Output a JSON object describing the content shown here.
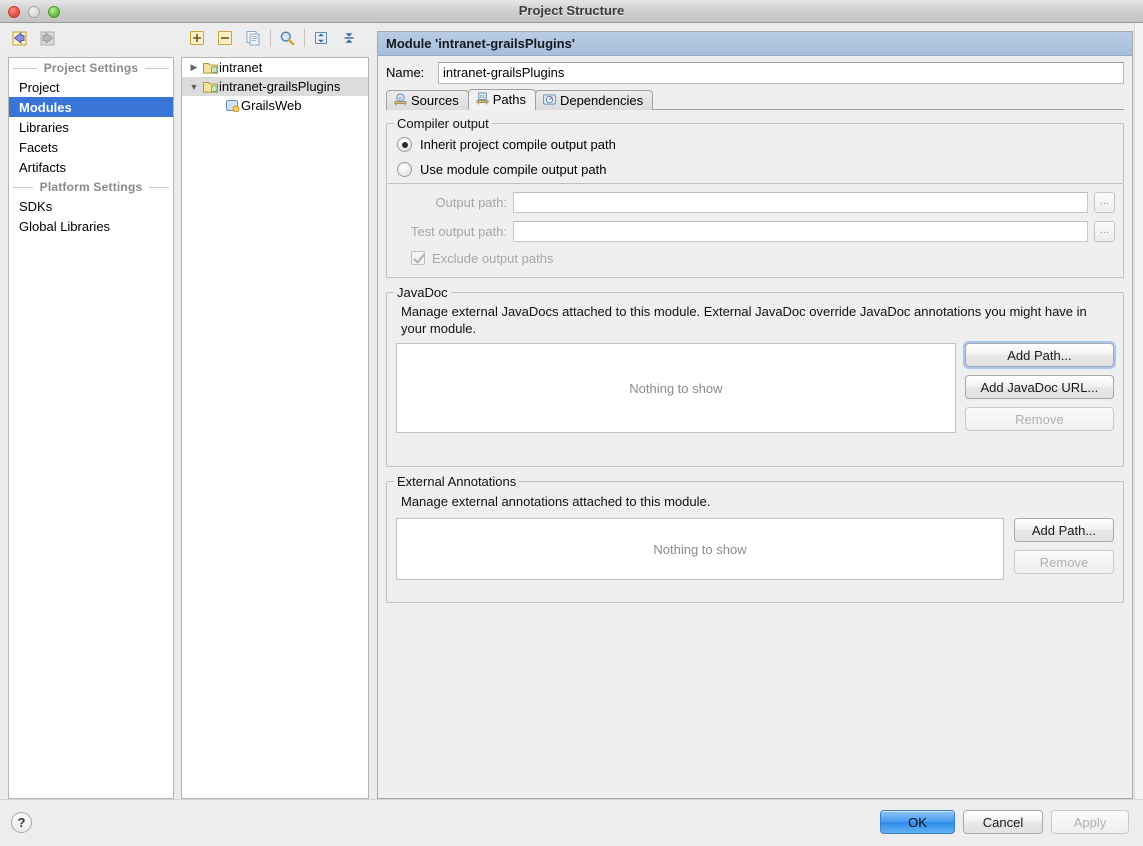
{
  "window": {
    "title": "Project Structure",
    "traffic_lights": [
      "close-button",
      "minimize-button",
      "maximize-button"
    ]
  },
  "nav_toolbar": {
    "items": [
      {
        "name": "back-button",
        "icon": "arrow-left-icon",
        "enabled": true
      },
      {
        "name": "forward-button",
        "icon": "arrow-right-icon",
        "enabled": false
      }
    ]
  },
  "tree_toolbar": {
    "items": [
      {
        "name": "add-button",
        "icon": "plus-icon"
      },
      {
        "name": "remove-button",
        "icon": "minus-icon"
      },
      {
        "name": "copy-button",
        "icon": "copy-icon"
      },
      {
        "name": "find-button",
        "icon": "search-icon"
      },
      {
        "name": "expand-all-button",
        "icon": "expand-all-icon"
      },
      {
        "name": "collapse-all-button",
        "icon": "collapse-all-icon"
      }
    ]
  },
  "sidebar": {
    "sections": [
      {
        "header": "Project Settings",
        "items": [
          {
            "label": "Project",
            "selected": false
          },
          {
            "label": "Modules",
            "selected": true
          },
          {
            "label": "Libraries",
            "selected": false
          },
          {
            "label": "Facets",
            "selected": false
          },
          {
            "label": "Artifacts",
            "selected": false
          }
        ]
      },
      {
        "header": "Platform Settings",
        "items": [
          {
            "label": "SDKs",
            "selected": false
          },
          {
            "label": "Global Libraries",
            "selected": false
          }
        ]
      }
    ]
  },
  "tree": {
    "rows": [
      {
        "label": "intranet",
        "twisty": "collapsed",
        "icon": "module-folder-icon",
        "indent": 0,
        "selected": false
      },
      {
        "label": "intranet-grailsPlugins",
        "twisty": "expanded",
        "icon": "module-folder-icon",
        "indent": 0,
        "selected": true
      },
      {
        "label": "GrailsWeb",
        "twisty": "none",
        "icon": "facet-icon",
        "indent": 1,
        "selected": false
      }
    ]
  },
  "editor": {
    "header_title": "Module 'intranet-grailsPlugins'",
    "name_label": "Name:",
    "name_value": "intranet-grailsPlugins",
    "name_placeholder": "",
    "tabs": [
      {
        "label": "Sources",
        "icon": "sources-icon",
        "active": false
      },
      {
        "label": "Paths",
        "icon": "paths-icon",
        "active": true
      },
      {
        "label": "Dependencies",
        "icon": "dependencies-icon",
        "active": false
      }
    ],
    "compiler_output": {
      "legend": "Compiler output",
      "radio_inherit": {
        "label": "Inherit project compile output path",
        "selected": true
      },
      "radio_module": {
        "label": "Use module compile output path",
        "selected": false
      },
      "output_path": {
        "label": "Output path:",
        "value": "",
        "browse": "...",
        "enabled": false
      },
      "test_output_path": {
        "label": "Test output path:",
        "value": "",
        "browse": "...",
        "enabled": false
      },
      "exclude_checkbox": {
        "label": "Exclude output paths",
        "checked": true,
        "enabled": false
      }
    },
    "javadoc": {
      "legend": "JavaDoc",
      "description": "Manage external JavaDocs attached to this module. External JavaDoc override JavaDoc annotations you might have in your module.",
      "empty_text": "Nothing to show",
      "buttons": [
        {
          "label": "Add Path...",
          "enabled": true,
          "focused": true
        },
        {
          "label": "Add JavaDoc URL...",
          "enabled": true,
          "focused": false
        },
        {
          "label": "Remove",
          "enabled": false,
          "focused": false
        }
      ]
    },
    "external_annotations": {
      "legend": "External Annotations",
      "description": "Manage external annotations attached to this module.",
      "empty_text": "Nothing to show",
      "buttons": [
        {
          "label": "Add Path...",
          "enabled": true,
          "focused": false
        },
        {
          "label": "Remove",
          "enabled": false,
          "focused": false
        }
      ]
    }
  },
  "bottom_bar": {
    "help_label": "?",
    "buttons": [
      {
        "label": "OK",
        "style": "default",
        "enabled": true
      },
      {
        "label": "Cancel",
        "style": "normal",
        "enabled": true
      },
      {
        "label": "Apply",
        "style": "normal",
        "enabled": false
      }
    ]
  },
  "colors": {
    "selection_blue": "#3875d7",
    "header_blue": "#a7bfdc",
    "default_button_blue": "#2e8bea",
    "window_bg": "#ececec",
    "panel_bg": "#efefef",
    "disabled_text": "#a6a6a6"
  }
}
